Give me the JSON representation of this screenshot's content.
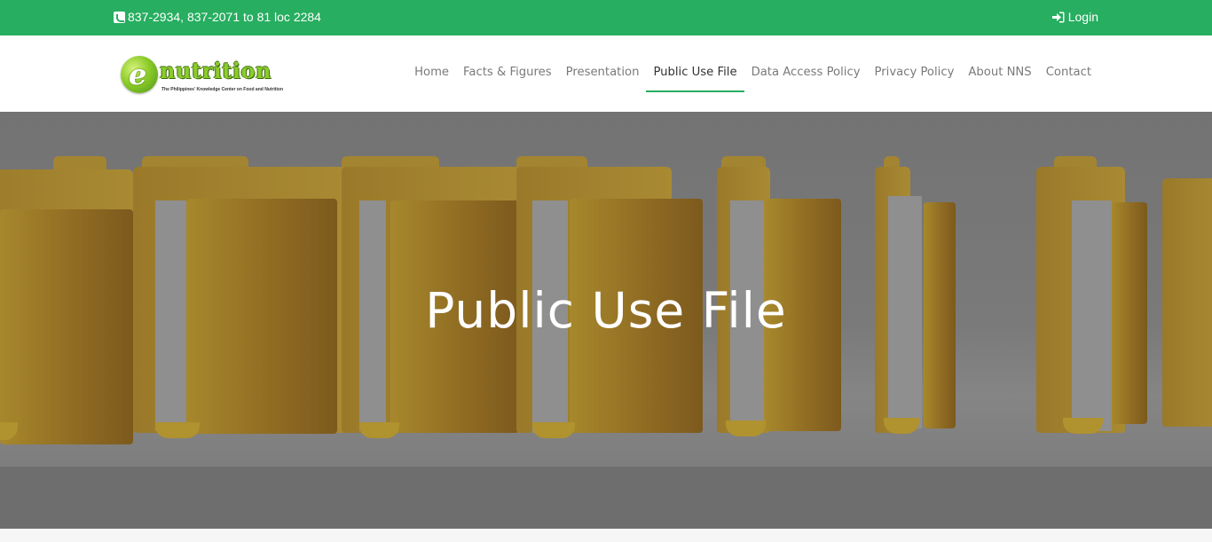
{
  "topbar": {
    "phone": "837-2934, 837-2071 to 81 loc 2284",
    "login_label": "Login"
  },
  "logo": {
    "letter": "e",
    "word": "nutrition",
    "tagline": "The Philippines' Knowledge Center on Food and Nutrition"
  },
  "nav": {
    "items": [
      {
        "label": "Home"
      },
      {
        "label": "Facts & Figures"
      },
      {
        "label": "Presentation"
      },
      {
        "label": "Public Use File"
      },
      {
        "label": "Data Access Policy"
      },
      {
        "label": "Privacy Policy"
      },
      {
        "label": "About NNS"
      },
      {
        "label": "Contact"
      }
    ],
    "active": "Public Use File"
  },
  "hero": {
    "title": "Public Use File"
  },
  "colors": {
    "brand_green": "#27ae60",
    "nav_text": "#7a7a7a",
    "hero_overlay": "#6e6e6e"
  },
  "icons": {
    "phone": "phone-square-icon",
    "login": "sign-in-icon"
  }
}
